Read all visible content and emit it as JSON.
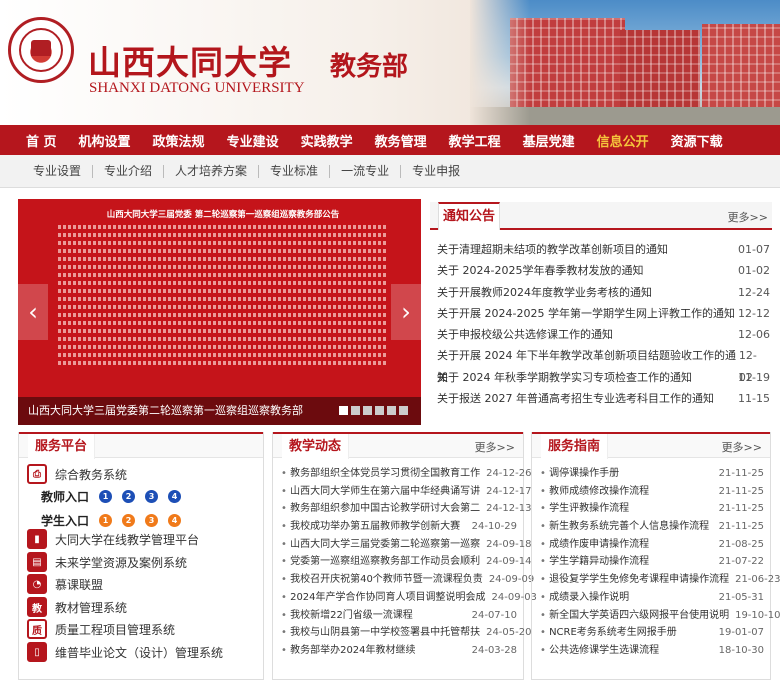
{
  "header": {
    "logo_alt": "SHANXI DATONG UNIVERSITY seal",
    "university_cn": "山西大同大学",
    "university_en": "SHANXI DATONG UNIVERSITY",
    "department": "教务部"
  },
  "nav": [
    "首 页",
    "机构设置",
    "政策法规",
    "专业建设",
    "实践教学",
    "教务管理",
    "教学工程",
    "基层党建",
    "信息公开",
    "资源下载"
  ],
  "nav_active": 8,
  "subnav": [
    "专业设置",
    "专业介绍",
    "人才培养方案",
    "专业标准",
    "一流专业",
    "专业申报"
  ],
  "slider": {
    "doc_title": "山西大同大学三届党委 第二轮巡察第一巡察组巡察教务部公告",
    "caption": "山西大同大学三届党委第二轮巡察第一巡察组巡察教务部",
    "prev_icon": "chevron-left-icon",
    "next_icon": "chevron-right-icon",
    "active_dot": 1
  },
  "notice": {
    "title": "通知公告",
    "more": "更多>>",
    "items": [
      {
        "t": "关于清理超期未结项的教学改革创新项目的通知",
        "d": "01-07"
      },
      {
        "t": "关于 2024-2025学年春季教材发放的通知",
        "d": "01-02"
      },
      {
        "t": "关于开展教师2024年度教学业务考核的通知",
        "d": "12-24"
      },
      {
        "t": "关于开展 2024-2025 学年第一学期学生网上评教工作的通知",
        "d": "12-12"
      },
      {
        "t": "关于申报校级公共选修课工作的通知",
        "d": "12-06"
      },
      {
        "t": "关于开展 2024 年下半年教学改革创新项目结题验收工作的通知",
        "d": "12-02"
      },
      {
        "t": "关于 2024 年秋季学期教学实习专项检查工作的通知",
        "d": "11-19"
      },
      {
        "t": "关于报送 2027 年普通高考招生专业选考科目工作的通知",
        "d": "11-15"
      }
    ]
  },
  "service": {
    "title": "服务平台",
    "items": [
      {
        "label": "综合教务系统",
        "icon": "printer-icon"
      },
      {
        "label": "大同大学在线教学管理平台",
        "icon": "bookmark-icon"
      },
      {
        "label": "未来学堂资源及案例系统",
        "icon": "book-icon"
      },
      {
        "label": "慕课联盟",
        "icon": "mooc-icon"
      },
      {
        "label": "教材管理系统",
        "icon": "textbook-icon"
      },
      {
        "label": "质量工程项目管理系统",
        "icon": "quality-icon"
      },
      {
        "label": "维普毕业论文（设计）管理系统",
        "icon": "thesis-icon"
      }
    ],
    "teacher_entry": "教师入口",
    "student_entry": "学生入口",
    "entry_nums": [
      "1",
      "2",
      "3",
      "4"
    ]
  },
  "dynamics": {
    "title": "教学动态",
    "more": "更多>>",
    "items": [
      {
        "t": "教务部组织全体党员学习贯彻全国教育工作",
        "d": "24-12-26"
      },
      {
        "t": "山西大同大学师生在第六届中华经典诵写讲",
        "d": "24-12-17"
      },
      {
        "t": "教务部组织参加中国古论教学研讨大会第二",
        "d": "24-12-13"
      },
      {
        "t": "我校成功举办第五届教师教学创新大赛",
        "d": "24-10-29"
      },
      {
        "t": "山西大同大学三届党委第二轮巡察第一巡察",
        "d": "24-09-18"
      },
      {
        "t": "党委第一巡察组巡察教务部工作动员会顺利",
        "d": "24-09-14"
      },
      {
        "t": "我校召开庆祝第40个教师节暨一流课程负责",
        "d": "24-09-09"
      },
      {
        "t": "2024年产学合作协同育人项目调整说明会成",
        "d": "24-09-03"
      },
      {
        "t": "我校新增22门省级一流课程",
        "d": "24-07-10"
      },
      {
        "t": "我校与山阴县第一中学校签署县中托管帮扶",
        "d": "24-05-20"
      },
      {
        "t": "教务部举办2024年教材继续",
        "d": "24-03-28"
      }
    ]
  },
  "guide": {
    "title": "服务指南",
    "more": "更多>>",
    "items": [
      {
        "t": "调停课操作手册",
        "d": "21-11-25"
      },
      {
        "t": "教师成绩修改操作流程",
        "d": "21-11-25"
      },
      {
        "t": "学生评教操作流程",
        "d": "21-11-25"
      },
      {
        "t": "新生教务系统完善个人信息操作流程",
        "d": "21-11-25"
      },
      {
        "t": "成绩作废申请操作流程",
        "d": "21-08-25"
      },
      {
        "t": "学生学籍异动操作流程",
        "d": "21-07-22"
      },
      {
        "t": "退役复学学生免修免考课程申请操作流程",
        "d": "21-06-23"
      },
      {
        "t": "成绩录入操作说明",
        "d": "21-05-31"
      },
      {
        "t": "新全国大学英语四六级网报平台使用说明",
        "d": "19-10-10"
      },
      {
        "t": "NCRE考务系统考生网报手册",
        "d": "19-01-07"
      },
      {
        "t": "公共选修课学生选课流程",
        "d": "18-10-30"
      }
    ]
  },
  "colors": {
    "brand": "#b5161d",
    "nav_active": "#f5c43c",
    "blue": "#1d4fb6",
    "orange": "#f07a1a"
  }
}
